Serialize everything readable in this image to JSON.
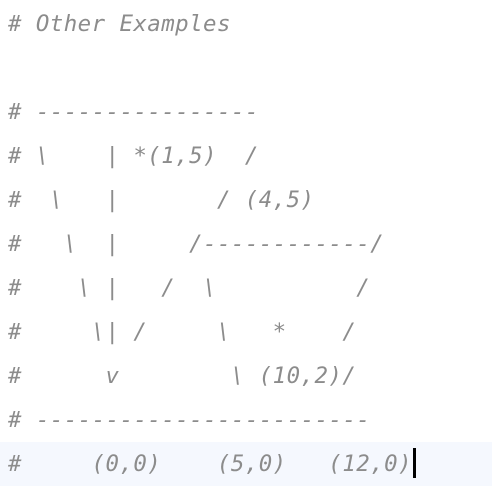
{
  "editor": {
    "lines": [
      "# Other Examples",
      "",
      "# ----------------",
      "# \\    | *(1,5)  /",
      "#  \\   |       / (4,5)",
      "#   \\  |     /------------/",
      "#    \\ |   /  \\          /",
      "#     \\| /     \\   *    /",
      "#      v        \\ (10,2)/",
      "# ------------------------",
      "#     (0,0)    (5,0)   (12,0)"
    ],
    "current_line_index": 10,
    "colors": {
      "comment_text": "#8c8c8c",
      "current_line_highlight": "#f5f8fe",
      "caret": "#000000",
      "background": "#ffffff"
    }
  }
}
